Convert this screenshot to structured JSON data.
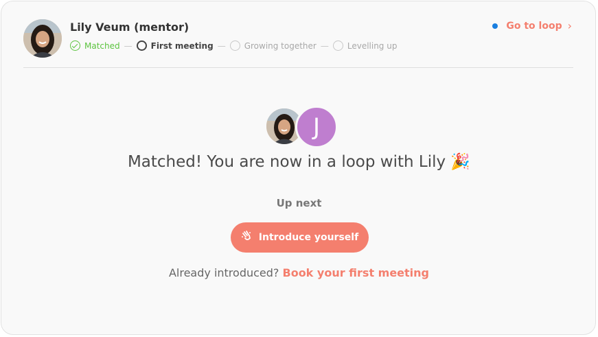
{
  "header": {
    "mentor_name": "Lily Veum (mentor)",
    "goto_label": "Go to loop",
    "goto_chevron": "›",
    "steps": [
      {
        "label": "Matched",
        "state": "done"
      },
      {
        "label": "First meeting",
        "state": "current"
      },
      {
        "label": "Growing together",
        "state": "todo"
      },
      {
        "label": "Levelling up",
        "state": "todo"
      }
    ]
  },
  "main": {
    "second_avatar_initial": "J",
    "headline": "Matched! You are now in a loop with Lily",
    "headline_emoji": "🎉",
    "up_next_label": "Up next",
    "intro_button_label": "Introduce yourself",
    "already_text": "Already introduced?",
    "book_link_label": "Book your first meeting"
  },
  "colors": {
    "accent": "#f47f6e",
    "success": "#5cc43f",
    "dot_blue": "#1a7fe0",
    "avatar_j": "#bf7ecf"
  },
  "icons": {
    "goto_dot": "status-dot-icon",
    "goto_chevron": "chevron-right-icon",
    "intro_icon": "wave-hand-icon",
    "step_done": "check-circle-icon",
    "step_current": "circle-outline-icon",
    "step_todo": "circle-outline-icon"
  }
}
